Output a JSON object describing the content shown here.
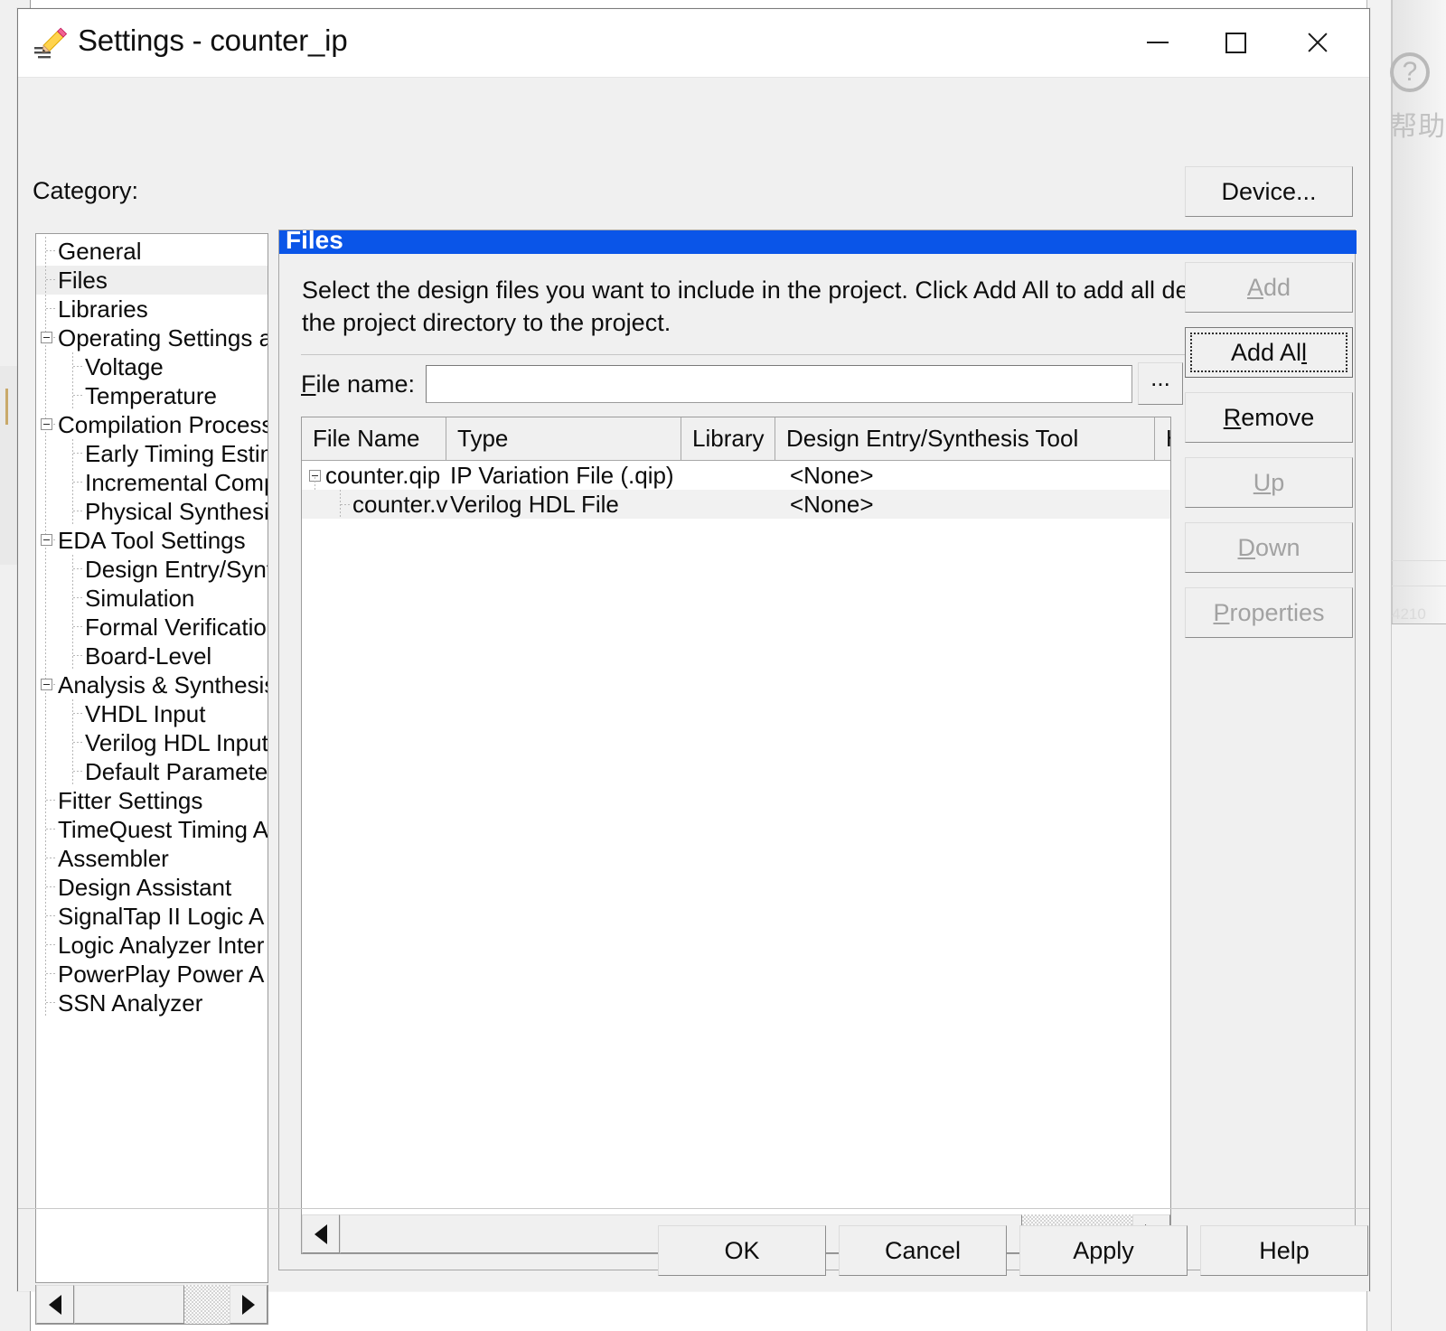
{
  "window": {
    "title": "Settings - counter_ip",
    "icon": "pencil-settings-icon",
    "minimize_label": "Minimize",
    "maximize_label": "Maximize",
    "close_label": "Close"
  },
  "toolbar": {
    "category_label": "Category:",
    "device_button": "Device..."
  },
  "category_tree": {
    "selected": "Files",
    "items": [
      {
        "label": "General",
        "depth": 0,
        "expander": false
      },
      {
        "label": "Files",
        "depth": 0,
        "expander": false
      },
      {
        "label": "Libraries",
        "depth": 0,
        "expander": false
      },
      {
        "label": "Operating Settings a",
        "depth": 0,
        "expander": true
      },
      {
        "label": "Voltage",
        "depth": 1,
        "expander": false
      },
      {
        "label": "Temperature",
        "depth": 1,
        "expander": false
      },
      {
        "label": "Compilation Process",
        "depth": 0,
        "expander": true
      },
      {
        "label": "Early Timing Estim",
        "depth": 1,
        "expander": false
      },
      {
        "label": "Incremental Comp",
        "depth": 1,
        "expander": false
      },
      {
        "label": "Physical Synthesis",
        "depth": 1,
        "expander": false
      },
      {
        "label": "EDA Tool Settings",
        "depth": 0,
        "expander": true
      },
      {
        "label": "Design Entry/Synt",
        "depth": 1,
        "expander": false
      },
      {
        "label": "Simulation",
        "depth": 1,
        "expander": false
      },
      {
        "label": "Formal Verification",
        "depth": 1,
        "expander": false
      },
      {
        "label": "Board-Level",
        "depth": 1,
        "expander": false
      },
      {
        "label": "Analysis & Synthesis",
        "depth": 0,
        "expander": true
      },
      {
        "label": "VHDL Input",
        "depth": 1,
        "expander": false
      },
      {
        "label": "Verilog HDL Input",
        "depth": 1,
        "expander": false
      },
      {
        "label": "Default Parameter",
        "depth": 1,
        "expander": false
      },
      {
        "label": "Fitter Settings",
        "depth": 0,
        "expander": false
      },
      {
        "label": "TimeQuest Timing A",
        "depth": 0,
        "expander": false
      },
      {
        "label": "Assembler",
        "depth": 0,
        "expander": false
      },
      {
        "label": "Design Assistant",
        "depth": 0,
        "expander": false
      },
      {
        "label": "SignalTap II Logic A",
        "depth": 0,
        "expander": false
      },
      {
        "label": "Logic Analyzer Inter",
        "depth": 0,
        "expander": false
      },
      {
        "label": "PowerPlay Power A",
        "depth": 0,
        "expander": false
      },
      {
        "label": "SSN Analyzer",
        "depth": 0,
        "expander": false
      }
    ]
  },
  "pane": {
    "header": "Files",
    "description": "Select the design files you want to include in the project. Click Add All to add all design files in the project directory to the project.",
    "filename_label": "File name:",
    "filename_value": "",
    "filename_placeholder": "",
    "browse_label": "..."
  },
  "file_table": {
    "columns": [
      "File Name",
      "Type",
      "Library",
      "Design Entry/Synthesis Tool",
      "HI"
    ],
    "rows": [
      {
        "file_name": "counter.qip",
        "type": "IP Variation File (.qip)",
        "library": "",
        "tool": "<None>",
        "depth": 0,
        "expander": true
      },
      {
        "file_name": "counter.v",
        "type": "Verilog HDL File",
        "library": "",
        "tool": "<None>",
        "depth": 1,
        "expander": false
      }
    ]
  },
  "side_buttons": {
    "add": {
      "label": "Add",
      "accel": "A",
      "enabled": false,
      "focused": false
    },
    "add_all": {
      "label": "Add All",
      "accel": "l",
      "enabled": true,
      "focused": true
    },
    "remove": {
      "label": "Remove",
      "accel": "R",
      "enabled": true,
      "focused": false
    },
    "up": {
      "label": "Up",
      "accel": "U",
      "enabled": false,
      "focused": false
    },
    "down": {
      "label": "Down",
      "accel": "D",
      "enabled": false,
      "focused": false
    },
    "properties": {
      "label": "Properties",
      "accel": "P",
      "enabled": false,
      "focused": false
    }
  },
  "dialog_buttons": {
    "ok": "OK",
    "cancel": "Cancel",
    "apply": "Apply",
    "help": "Help"
  },
  "scrollbars": {
    "left_arrow_icon": "triangle-left-icon",
    "right_arrow_icon": "triangle-right-icon"
  },
  "background": {
    "help_icon": "question-mark-icon",
    "help_text": "帮助",
    "faint_number": "4210"
  },
  "colors": {
    "header_blue": "#0a55e8",
    "dialog_face": "#f0f0f0",
    "selection_grey": "#eeeeee",
    "text": "#0d0d0d",
    "disabled_text": "#a2a2a2"
  }
}
